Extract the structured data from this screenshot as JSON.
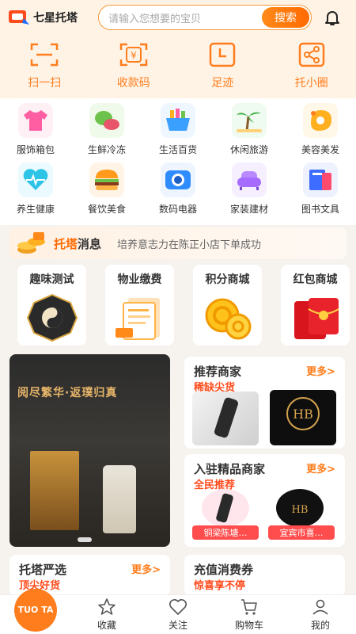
{
  "header": {
    "app_name": "七星托塔",
    "search_placeholder": "请输入您想要的宝贝",
    "search_button": "搜索"
  },
  "quick_actions": [
    {
      "label": "扫一扫",
      "icon": "scan-icon"
    },
    {
      "label": "收款码",
      "icon": "payment-code-icon"
    },
    {
      "label": "足迹",
      "icon": "footprint-icon"
    },
    {
      "label": "托小圈",
      "icon": "share-circle-icon"
    }
  ],
  "categories": [
    {
      "label": "服饰箱包",
      "icon": "clothing-icon",
      "color": "#ff5fa2"
    },
    {
      "label": "生鲜冷冻",
      "icon": "fresh-food-icon",
      "color": "#6cc24a"
    },
    {
      "label": "生活百货",
      "icon": "basket-icon",
      "color": "#3aa0ff"
    },
    {
      "label": "休闲旅游",
      "icon": "palm-tree-icon",
      "color": "#3cb043"
    },
    {
      "label": "美容美发",
      "icon": "beauty-icon",
      "color": "#ffb020"
    },
    {
      "label": "养生健康",
      "icon": "heart-health-icon",
      "color": "#2ec4e8"
    },
    {
      "label": "餐饮美食",
      "icon": "burger-icon",
      "color": "#ff9a1a"
    },
    {
      "label": "数码电器",
      "icon": "camera-icon",
      "color": "#2e8cff"
    },
    {
      "label": "家装建材",
      "icon": "sofa-icon",
      "color": "#a66bff"
    },
    {
      "label": "图书文具",
      "icon": "books-icon",
      "color": "#3d6cff"
    }
  ],
  "news": {
    "title_a": "托塔",
    "title_b": "消息",
    "text": "培养意志力在陈正小店下单成功"
  },
  "services": [
    {
      "label": "趣味测试",
      "icon": "bagua-icon"
    },
    {
      "label": "物业缴费",
      "icon": "bill-icon"
    },
    {
      "label": "积分商城",
      "icon": "coins-icon"
    },
    {
      "label": "红包商城",
      "icon": "red-envelope-icon"
    }
  ],
  "banner": {
    "headline": "阅尽繁华·返璞归真"
  },
  "recommend": {
    "title": "推荐商家",
    "more": "更多>",
    "subtitle": "稀缺尖货"
  },
  "featured": {
    "title": "入驻精品商家",
    "more": "更多>",
    "subtitle": "全民推荐",
    "tag1": "铜梁陈塘…",
    "tag2": "宜宾市喜…"
  },
  "select": {
    "title": "托塔严选",
    "more": "更多>",
    "subtitle": "顶尖好货"
  },
  "recharge": {
    "title": "充值消费券",
    "subtitle": "惊喜享不停"
  },
  "tabs": [
    {
      "label": "",
      "icon": "home-logo"
    },
    {
      "label": "收藏",
      "icon": "star-icon"
    },
    {
      "label": "关注",
      "icon": "heart-icon"
    },
    {
      "label": "购物车",
      "icon": "cart-icon"
    },
    {
      "label": "我的",
      "icon": "user-icon"
    }
  ],
  "tab_home_text": "TUO TA",
  "colors": {
    "accent": "#ff7d1c",
    "red": "#ff4b1c",
    "bg": "#f6f2ee"
  }
}
